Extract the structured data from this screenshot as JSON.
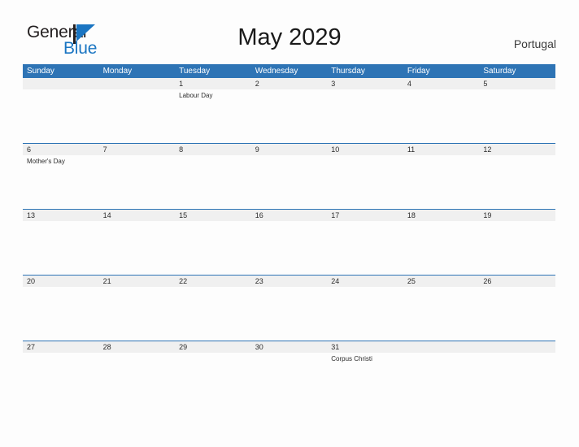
{
  "brand": {
    "name_part1": "General",
    "name_part2": "Blue",
    "flag_icon": "triangle-flag-icon",
    "accent_color": "#1a75c2"
  },
  "header": {
    "title": "May 2029",
    "region": "Portugal"
  },
  "colors": {
    "header_bar": "#2e74b5",
    "date_band": "#f0f0f0",
    "rule": "#2e74b5",
    "text": "#2b2b2b",
    "page_background": "#fdfdfd"
  },
  "calendar": {
    "month": "May",
    "year": "2029",
    "weekday_headers": [
      "Sunday",
      "Monday",
      "Tuesday",
      "Wednesday",
      "Thursday",
      "Friday",
      "Saturday"
    ],
    "weeks": [
      {
        "days": [
          {
            "date": "",
            "event": ""
          },
          {
            "date": "",
            "event": ""
          },
          {
            "date": "1",
            "event": "Labour Day"
          },
          {
            "date": "2",
            "event": ""
          },
          {
            "date": "3",
            "event": ""
          },
          {
            "date": "4",
            "event": ""
          },
          {
            "date": "5",
            "event": ""
          }
        ]
      },
      {
        "days": [
          {
            "date": "6",
            "event": "Mother's Day"
          },
          {
            "date": "7",
            "event": ""
          },
          {
            "date": "8",
            "event": ""
          },
          {
            "date": "9",
            "event": ""
          },
          {
            "date": "10",
            "event": ""
          },
          {
            "date": "11",
            "event": ""
          },
          {
            "date": "12",
            "event": ""
          }
        ]
      },
      {
        "days": [
          {
            "date": "13",
            "event": ""
          },
          {
            "date": "14",
            "event": ""
          },
          {
            "date": "15",
            "event": ""
          },
          {
            "date": "16",
            "event": ""
          },
          {
            "date": "17",
            "event": ""
          },
          {
            "date": "18",
            "event": ""
          },
          {
            "date": "19",
            "event": ""
          }
        ]
      },
      {
        "days": [
          {
            "date": "20",
            "event": ""
          },
          {
            "date": "21",
            "event": ""
          },
          {
            "date": "22",
            "event": ""
          },
          {
            "date": "23",
            "event": ""
          },
          {
            "date": "24",
            "event": ""
          },
          {
            "date": "25",
            "event": ""
          },
          {
            "date": "26",
            "event": ""
          }
        ]
      },
      {
        "days": [
          {
            "date": "27",
            "event": ""
          },
          {
            "date": "28",
            "event": ""
          },
          {
            "date": "29",
            "event": ""
          },
          {
            "date": "30",
            "event": ""
          },
          {
            "date": "31",
            "event": "Corpus Christi"
          },
          {
            "date": "",
            "event": ""
          },
          {
            "date": "",
            "event": ""
          }
        ]
      }
    ]
  }
}
